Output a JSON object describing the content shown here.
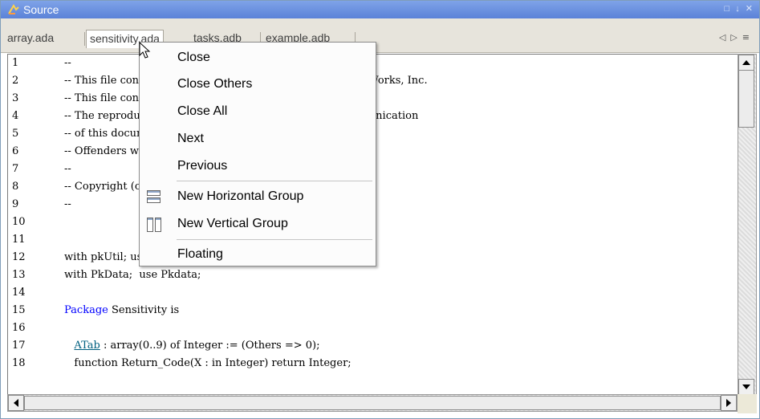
{
  "window": {
    "title": "Source",
    "controls": "□ ↓ ✕"
  },
  "tabs": [
    {
      "label": "array.ada",
      "active": false
    },
    {
      "label": "sensitivity.ada",
      "active": true
    },
    {
      "label": "tasks.adb",
      "active": false
    },
    {
      "label": "example.adb",
      "active": false
    }
  ],
  "tabnav": {
    "prev": "◁",
    "next": "▷",
    "list": "≡"
  },
  "code_lines": [
    {
      "n": "1",
      "t": "--"
    },
    {
      "n": "2",
      "t": "-- This file contains the confidential property of The MathWorks, Inc."
    },
    {
      "n": "3",
      "t": "-- This file contains proprietary information."
    },
    {
      "n": "4",
      "t": "-- The reproduction, modification, utilization or the communication"
    },
    {
      "n": "5",
      "t": "-- of this document is strictly prohibited."
    },
    {
      "n": "6",
      "t": "-- Offenders will be liable for the payment of damages."
    },
    {
      "n": "7",
      "t": "--"
    },
    {
      "n": "8",
      "t": "-- Copyright (c) The MathWorks. All rights reserved."
    },
    {
      "n": "9",
      "t": "--"
    },
    {
      "n": "10",
      "t": ""
    },
    {
      "n": "11",
      "t": ""
    },
    {
      "n": "12",
      "t": "with pkUtil; use pkUtil;"
    },
    {
      "n": "13",
      "t": "with PkData;  use Pkdata;"
    },
    {
      "n": "14",
      "t": ""
    },
    {
      "n": "15",
      "kw": "Package",
      "t": " Sensitivity is"
    },
    {
      "n": "16",
      "t": ""
    },
    {
      "n": "17",
      "indent": "   ",
      "ty": "ATab",
      "t": " : array(0..9) of Integer := (Others => 0);"
    },
    {
      "n": "18",
      "indent": "   ",
      "t": "function Return_Code(X : in Integer) return Integer;"
    }
  ],
  "context_menu": {
    "items": [
      {
        "label": "Close",
        "icon": ""
      },
      {
        "label": "Close Others",
        "icon": ""
      },
      {
        "label": "Close All",
        "icon": ""
      },
      {
        "label": "Next",
        "icon": ""
      },
      {
        "label": "Previous",
        "icon": ""
      },
      {
        "label": "New Horizontal Group",
        "icon": "horizontal-split-icon"
      },
      {
        "label": "New Vertical Group",
        "icon": "vertical-split-icon"
      },
      {
        "label": "Floating",
        "icon": ""
      }
    ]
  }
}
